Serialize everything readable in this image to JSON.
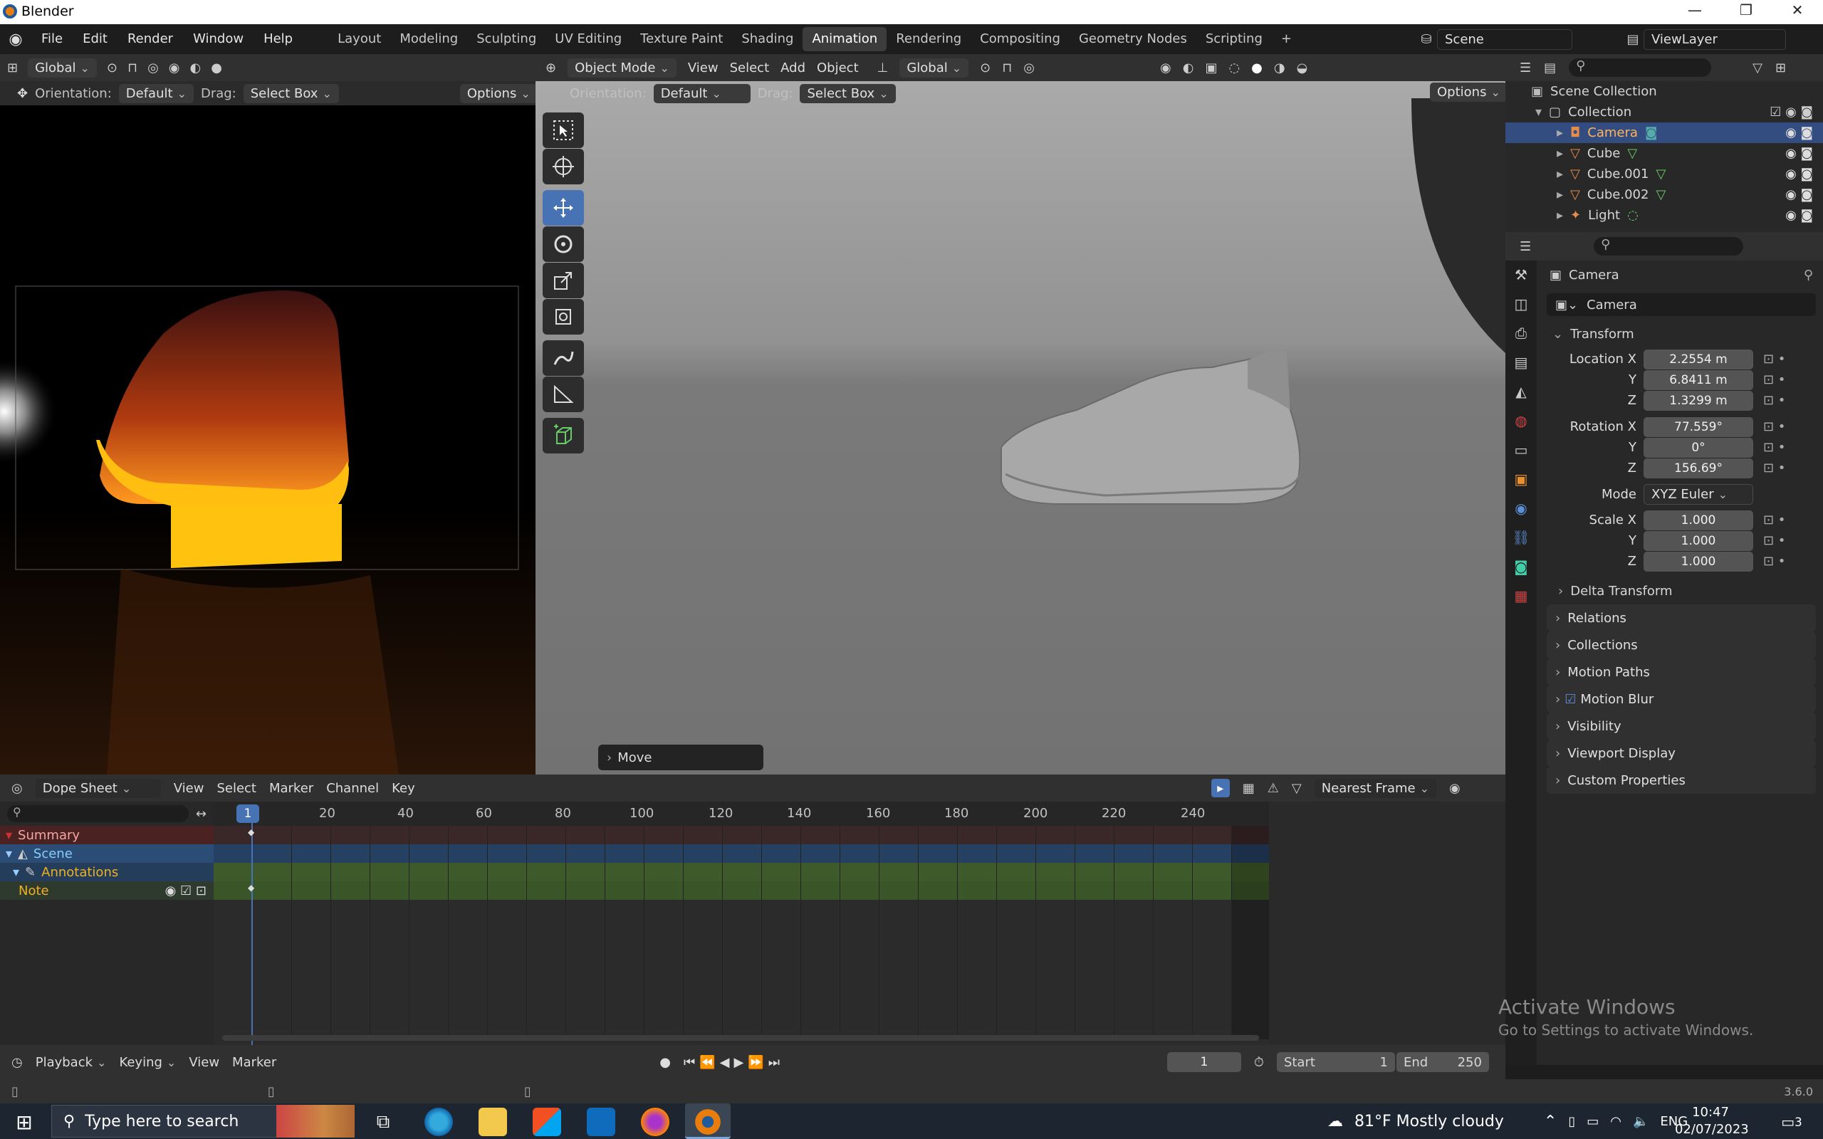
{
  "titlebar": {
    "title": "Blender",
    "minimize": "—",
    "maximize": "❐",
    "close": "✕"
  },
  "menu": {
    "items": [
      "File",
      "Edit",
      "Render",
      "Window",
      "Help"
    ]
  },
  "workspaces": {
    "tabs": [
      "Layout",
      "Modeling",
      "Sculpting",
      "UV Editing",
      "Texture Paint",
      "Shading",
      "Animation",
      "Rendering",
      "Compositing",
      "Geometry Nodes",
      "Scripting"
    ],
    "active": "Animation",
    "add": "+"
  },
  "scene": {
    "name": "Scene",
    "viewlayer": "ViewLayer"
  },
  "left_editor": {
    "orientation_selector": "Global",
    "orientation_label": "Orientation:",
    "orientation_value": "Default",
    "drag_label": "Drag:",
    "drag_value": "Select Box",
    "options": "Options"
  },
  "viewport": {
    "mode": "Object Mode",
    "menus": [
      "View",
      "Select",
      "Add",
      "Object"
    ],
    "transform_orientation": "Global",
    "orientation_label": "Orientation:",
    "orientation_value": "Default",
    "drag_label": "Drag:",
    "drag_value": "Select Box",
    "options": "Options",
    "last_op": "Move"
  },
  "outliner": {
    "root": "Scene Collection",
    "collection": "Collection",
    "items": [
      "Camera",
      "Cube",
      "Cube.001",
      "Cube.002",
      "Light"
    ],
    "selected": "Camera"
  },
  "properties": {
    "object_name": "Camera",
    "datablock": "Camera",
    "transform_title": "Transform",
    "location": {
      "label": "Location X",
      "x": "2.2554 m",
      "y": "6.8411 m",
      "z": "1.3299 m"
    },
    "rotation": {
      "label": "Rotation X",
      "x": "77.559°",
      "y": "0°",
      "z": "156.69°"
    },
    "mode_label": "Mode",
    "mode_value": "XYZ Euler",
    "scale": {
      "label": "Scale X",
      "x": "1.000",
      "y": "1.000",
      "z": "1.000"
    },
    "axis_y": "Y",
    "axis_z": "Z",
    "delta": "Delta Transform",
    "panels": [
      "Relations",
      "Collections",
      "Motion Paths",
      "Motion Blur",
      "Visibility",
      "Viewport Display",
      "Custom Properties"
    ]
  },
  "dopesheet": {
    "editor": "Dope Sheet",
    "menus": [
      "View",
      "Select",
      "Marker",
      "Channel",
      "Key"
    ],
    "snap": "Nearest Frame",
    "current_frame": "1",
    "ruler": [
      "20",
      "40",
      "60",
      "80",
      "100",
      "120",
      "140",
      "160",
      "180",
      "200",
      "220",
      "240"
    ],
    "channels": [
      "Summary",
      "Scene",
      "Annotations",
      "Note"
    ]
  },
  "timeline": {
    "menus": [
      "Playback",
      "Keying",
      "View",
      "Marker"
    ],
    "frame": "1",
    "start_label": "Start",
    "start": "1",
    "end_label": "End",
    "end": "250"
  },
  "status": {
    "version": "3.6.0"
  },
  "watermark": {
    "line1": "Activate Windows",
    "line2": "Go to Settings to activate Windows."
  },
  "taskbar": {
    "search_placeholder": "Type here to search",
    "weather": "81°F  Mostly cloudy",
    "lang": "ENG",
    "time": "10:47",
    "date": "02/07/2023",
    "notif": "3"
  }
}
